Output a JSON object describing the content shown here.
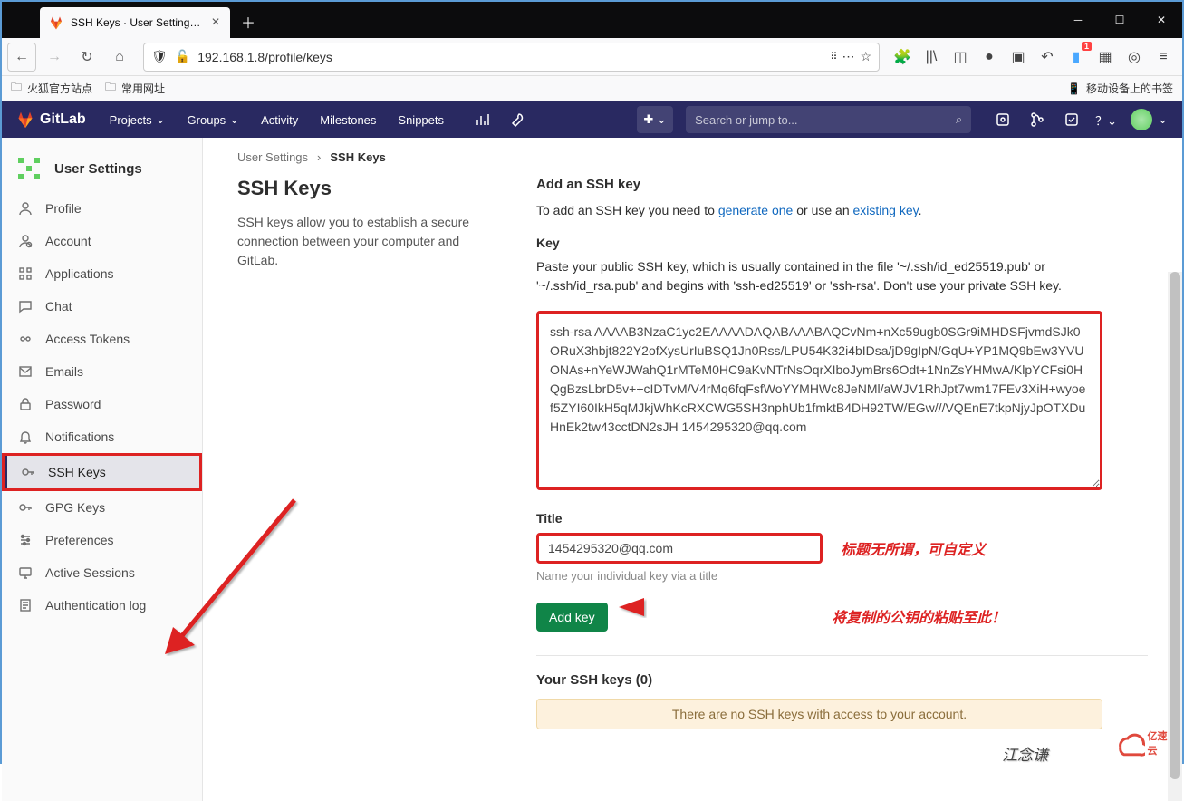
{
  "browser": {
    "tab_title": "SSH Keys · User Settings · Git...",
    "url": "192.168.1.8/profile/keys",
    "bookmarks": {
      "b1": "火狐官方站点",
      "b2": "常用网址",
      "mobile": "移动设备上的书签"
    }
  },
  "gitlab_header": {
    "brand": "GitLab",
    "menu": {
      "projects": "Projects",
      "groups": "Groups",
      "activity": "Activity",
      "milestones": "Milestones",
      "snippets": "Snippets"
    },
    "search_placeholder": "Search or jump to...",
    "plus_badge": "1"
  },
  "sidebar": {
    "title": "User Settings",
    "items": [
      {
        "label": "Profile",
        "icon": "user"
      },
      {
        "label": "Account",
        "icon": "account"
      },
      {
        "label": "Applications",
        "icon": "apps"
      },
      {
        "label": "Chat",
        "icon": "chat"
      },
      {
        "label": "Access Tokens",
        "icon": "token"
      },
      {
        "label": "Emails",
        "icon": "mail"
      },
      {
        "label": "Password",
        "icon": "lock"
      },
      {
        "label": "Notifications",
        "icon": "bell"
      },
      {
        "label": "SSH Keys",
        "icon": "key"
      },
      {
        "label": "GPG Keys",
        "icon": "key"
      },
      {
        "label": "Preferences",
        "icon": "prefs"
      },
      {
        "label": "Active Sessions",
        "icon": "sessions"
      },
      {
        "label": "Authentication log",
        "icon": "log"
      }
    ]
  },
  "breadcrumbs": {
    "root": "User Settings",
    "current": "SSH Keys"
  },
  "left_col": {
    "heading": "SSH Keys",
    "desc": "SSH keys allow you to establish a secure connection between your computer and GitLab."
  },
  "form": {
    "add_heading": "Add an SSH key",
    "add_help_pre": "To add an SSH key you need to ",
    "generate_link": "generate one",
    "add_help_mid": " or use an ",
    "existing_link": "existing key",
    "key_label": "Key",
    "key_help": "Paste your public SSH key, which is usually contained in the file '~/.ssh/id_ed25519.pub' or '~/.ssh/id_rsa.pub' and begins with 'ssh-ed25519' or 'ssh-rsa'. Don't use your private SSH key.",
    "key_value": "ssh-rsa AAAAB3NzaC1yc2EAAAADAQABAAABAQCvNm+nXc59ugb0SGr9iMHDSFjvmdSJk0ORuX3hbjt822Y2ofXysUrIuBSQ1Jn0Rss/LPU54K32i4bIDsa/jD9gIpN/GqU+YP1MQ9bEw3YVUONAs+nYeWJWahQ1rMTeM0HC9aKvNTrNsOqrXIboJymBrs6Odt+1NnZsYHMwA/KlpYCFsi0HQgBzsLbrD5v++cIDTvM/V4rMq6fqFsfWoYYMHWc8JeNMl/aWJV1RhJpt7wm17FEv3XiH+wyoef5ZYI60IkH5qMJkjWhKcRXCWG5SH3nphUb1fmktB4DH92TW/EGw///VQEnE7tkpNjyJpOTXDuHnEk2tw43cctDN2sJH 1454295320@qq.com",
    "annotation_key": "将复制的公钥的粘贴至此！",
    "title_label": "Title",
    "title_value": "1454295320@qq.com",
    "annotation_title": "标题无所谓，可自定义",
    "title_hint": "Name your individual key via a title",
    "add_button": "Add key"
  },
  "keys_list": {
    "heading": "Your SSH keys (0)",
    "empty": "There are no SSH keys with access to your account."
  },
  "watermark": "江念谦",
  "logo_text": "亿速云"
}
